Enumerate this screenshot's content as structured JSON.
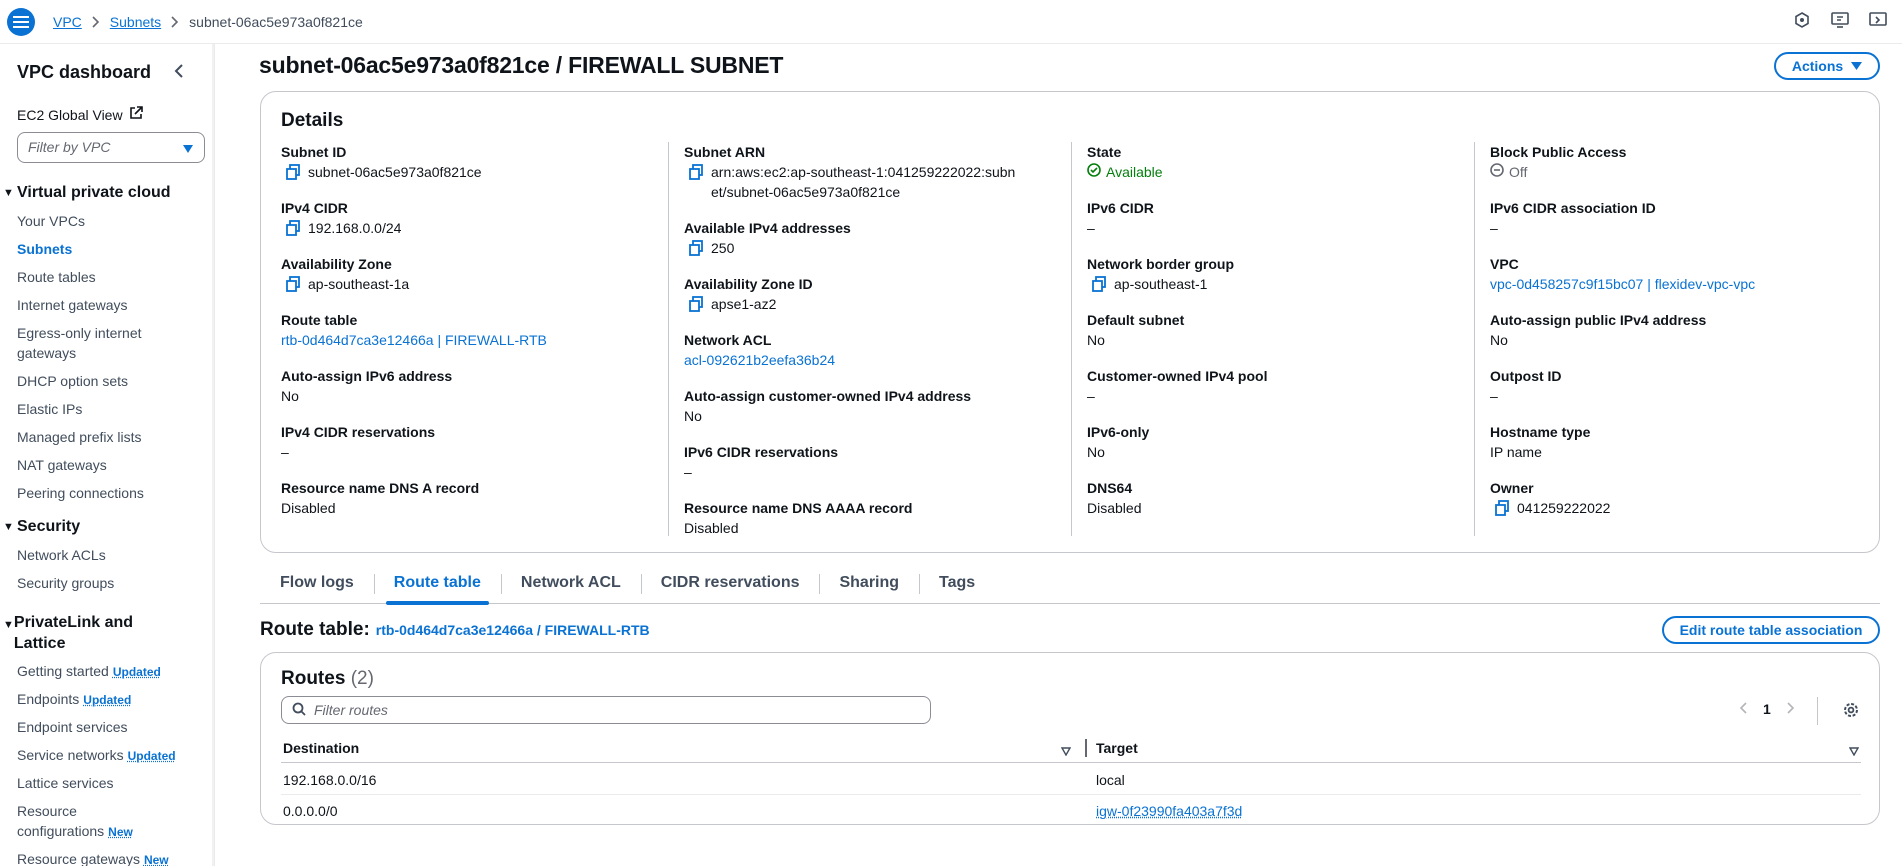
{
  "breadcrumb": {
    "root": "VPC",
    "parent": "Subnets",
    "current": "subnet-06ac5e973a0f821ce"
  },
  "sidebar": {
    "title": "VPC dashboard",
    "ec2_global_view": "EC2 Global View",
    "filter_placeholder": "Filter by VPC",
    "sections": [
      {
        "title": "Virtual private cloud",
        "items": [
          "Your VPCs",
          "Subnets",
          "Route tables",
          "Internet gateways",
          "Egress-only internet gateways",
          "DHCP option sets",
          "Elastic IPs",
          "Managed prefix lists",
          "NAT gateways",
          "Peering connections"
        ]
      },
      {
        "title": "Security",
        "items": [
          "Network ACLs",
          "Security groups"
        ]
      },
      {
        "title": "PrivateLink and Lattice",
        "items": [
          "Getting started",
          "Endpoints",
          "Endpoint services",
          "Service networks",
          "Lattice services",
          "Resource configurations",
          "Resource gateways"
        ]
      }
    ],
    "active_item": "Subnets",
    "badges": {
      "updated": "Updated",
      "new": "New"
    }
  },
  "page": {
    "title": "subnet-06ac5e973a0f821ce / FIREWALL SUBNET",
    "actions_label": "Actions"
  },
  "details": {
    "title": "Details",
    "columns": [
      [
        {
          "label": "Subnet ID",
          "value": "subnet-06ac5e973a0f821ce",
          "copy": true
        },
        {
          "label": "IPv4 CIDR",
          "value": "192.168.0.0/24",
          "copy": true
        },
        {
          "label": "Availability Zone",
          "value": "ap-southeast-1a",
          "copy": true
        },
        {
          "label": "Route table",
          "value": "rtb-0d464d7ca3e12466a | FIREWALL-RTB",
          "link": true
        },
        {
          "label": "Auto-assign IPv6 address",
          "value": "No"
        },
        {
          "label": "IPv4 CIDR reservations",
          "value": "–"
        },
        {
          "label": "Resource name DNS A record",
          "value": "Disabled"
        }
      ],
      [
        {
          "label": "Subnet ARN",
          "value": "arn:aws:ec2:ap-southeast-1:041259222022:subnet/subnet-06ac5e973a0f821ce",
          "copy": true
        },
        {
          "label": "Available IPv4 addresses",
          "value": "250",
          "copy": true
        },
        {
          "label": "Availability Zone ID",
          "value": "apse1-az2",
          "copy": true
        },
        {
          "label": "Network ACL",
          "value": "acl-092621b2eefa36b24",
          "link": true
        },
        {
          "label": "Auto-assign customer-owned IPv4 address",
          "value": "No"
        },
        {
          "label": "IPv6 CIDR reservations",
          "value": "–"
        },
        {
          "label": "Resource name DNS AAAA record",
          "value": "Disabled"
        }
      ],
      [
        {
          "label": "State",
          "value": "Available",
          "status": "ok"
        },
        {
          "label": "IPv6 CIDR",
          "value": "–"
        },
        {
          "label": "Network border group",
          "value": "ap-southeast-1",
          "copy": true
        },
        {
          "label": "Default subnet",
          "value": "No"
        },
        {
          "label": "Customer-owned IPv4 pool",
          "value": "–"
        },
        {
          "label": "IPv6-only",
          "value": "No"
        },
        {
          "label": "DNS64",
          "value": "Disabled"
        }
      ],
      [
        {
          "label": "Block Public Access",
          "value": "Off",
          "status": "off"
        },
        {
          "label": "IPv6 CIDR association ID",
          "value": "–"
        },
        {
          "label": "VPC",
          "value": "vpc-0d458257c9f15bc07 | flexidev-vpc-vpc",
          "link": true
        },
        {
          "label": "Auto-assign public IPv4 address",
          "value": "No"
        },
        {
          "label": "Outpost ID",
          "value": "–"
        },
        {
          "label": "Hostname type",
          "value": "IP name"
        },
        {
          "label": "Owner",
          "value": "041259222022",
          "copy": true
        }
      ]
    ]
  },
  "tabs": [
    "Flow logs",
    "Route table",
    "Network ACL",
    "CIDR reservations",
    "Sharing",
    "Tags"
  ],
  "active_tab": "Route table",
  "route_table": {
    "label": "Route table:",
    "link": "rtb-0d464d7ca3e12466a / FIREWALL-RTB",
    "edit_label": "Edit route table association",
    "routes_title": "Routes",
    "routes_count": "(2)",
    "filter_placeholder": "Filter routes",
    "page": "1",
    "columns": [
      "Destination",
      "Target"
    ],
    "rows": [
      {
        "destination": "192.168.0.0/16",
        "target": "local",
        "target_link": false
      },
      {
        "destination": "0.0.0.0/0",
        "target": "igw-0f23990fa403a7f3d",
        "target_link": true
      }
    ]
  },
  "colors": {
    "accent": "#0972d3",
    "success": "#037f0c",
    "border": "#c6c6cd",
    "muted": "#656871"
  }
}
